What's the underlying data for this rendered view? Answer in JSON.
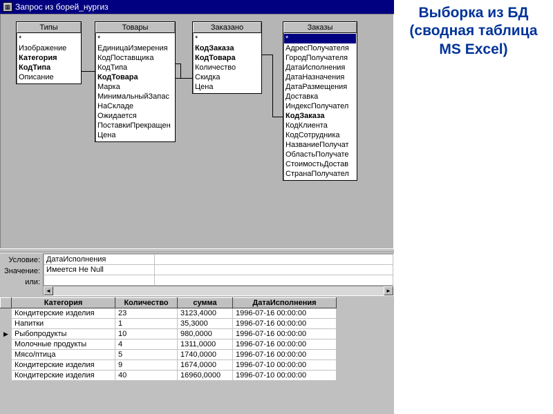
{
  "rightTitle": "Выборка из БД (сводная таблица MS Excel)",
  "window": {
    "title": "Запрос из борей_нургиз"
  },
  "tables": {
    "t1": {
      "title": "Типы",
      "fields": [
        "*",
        "Изображение",
        "Категория",
        "КодТипа",
        "Описание"
      ],
      "bold": [
        2,
        3
      ]
    },
    "t2": {
      "title": "Товары",
      "fields": [
        "*",
        "ЕдиницаИзмерения",
        "КодПоставщика",
        "КодТипа",
        "КодТовара",
        "Марка",
        "МинимальныйЗапас",
        "НаСкладе",
        "Ожидается",
        "ПоставкиПрекращен",
        "Цена"
      ],
      "bold": [
        4
      ]
    },
    "t3": {
      "title": "Заказано",
      "fields": [
        "*",
        "КодЗаказа",
        "КодТовара",
        "Количество",
        "Скидка",
        "Цена"
      ],
      "bold": [
        1,
        2
      ]
    },
    "t4": {
      "title": "Заказы",
      "fields": [
        "*",
        "АдресПолучателя",
        "ГородПолучателя",
        "ДатаИсполнения",
        "ДатаНазначения",
        "ДатаРазмещения",
        "Доставка",
        "ИндексПолучател",
        "КодЗаказа",
        "КодКлиента",
        "КодСотрудника",
        "НазваниеПолучат",
        "ОбластьПолучате",
        "СтоимостьДостав",
        "СтранаПолучател"
      ],
      "bold": [
        8
      ],
      "selected": 0
    }
  },
  "criteria": {
    "labels": {
      "cond": "Условие:",
      "val": "Значение:",
      "or": "или:"
    },
    "rows": [
      "ДатаИсполнения",
      "Имеется Не Null"
    ]
  },
  "result": {
    "headers": [
      "Категория",
      "Количество",
      "сумма",
      "ДатаИсполнения"
    ],
    "rows": [
      {
        "cat": "Кондитерские изделия",
        "qty": "23",
        "sum": "3123,4000",
        "date": "1996-07-16 00:00:00"
      },
      {
        "cat": "Напитки",
        "qty": "1",
        "sum": "35,3000",
        "date": "1996-07-16 00:00:00"
      },
      {
        "cat": "Рыбопродукты",
        "qty": "10",
        "sum": "980,0000",
        "date": "1996-07-16 00:00:00",
        "current": true
      },
      {
        "cat": "Молочные продукты",
        "qty": "4",
        "sum": "1311,0000",
        "date": "1996-07-16 00:00:00"
      },
      {
        "cat": "Мясо/птица",
        "qty": "5",
        "sum": "1740,0000",
        "date": "1996-07-16 00:00:00"
      },
      {
        "cat": "Кондитерские изделия",
        "qty": "9",
        "sum": "1674,0000",
        "date": "1996-07-10 00:00:00"
      },
      {
        "cat": "Кондитерские изделия",
        "qty": "40",
        "sum": "16960,0000",
        "date": "1996-07-10 00:00:00"
      }
    ]
  }
}
